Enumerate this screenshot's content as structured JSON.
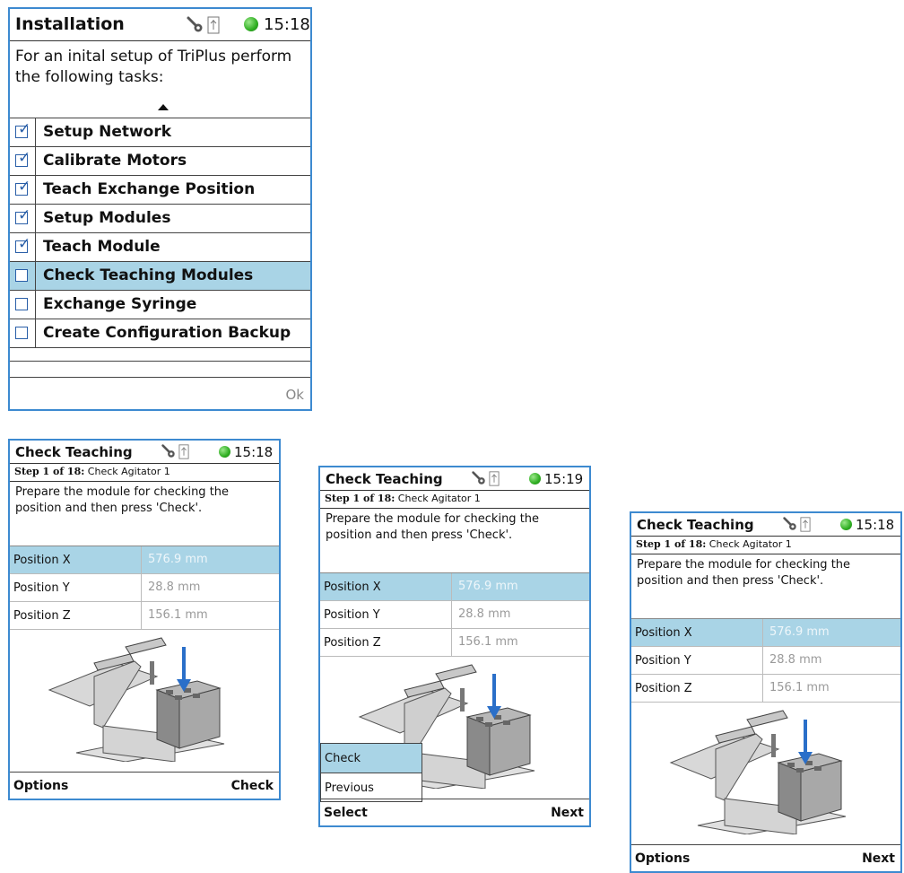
{
  "install": {
    "title": "Installation",
    "time": "15:18",
    "intro": "For an inital setup of TriPlus perform the following tasks:",
    "tasks": [
      {
        "label": "Setup Network",
        "checked": true
      },
      {
        "label": "Calibrate Motors",
        "checked": true
      },
      {
        "label": "Teach Exchange Position",
        "checked": true
      },
      {
        "label": "Setup Modules",
        "checked": true
      },
      {
        "label": "Teach Module",
        "checked": true
      },
      {
        "label": "Check Teaching Modules",
        "checked": false
      },
      {
        "label": "Exchange Syringe",
        "checked": false
      },
      {
        "label": "Create Configuration Backup",
        "checked": false
      }
    ],
    "ok_label": "Ok"
  },
  "check_screens": [
    {
      "title": "Check Teaching",
      "time": "15:18",
      "step_prefix": "Step 1 of 18:",
      "step_name": "Check Agitator 1",
      "instruction": "Prepare the module for checking the position and then press 'Check'.",
      "positions": [
        {
          "label": "Position X",
          "value": "576.9 mm"
        },
        {
          "label": "Position Y",
          "value": "28.8 mm"
        },
        {
          "label": "Position Z",
          "value": "156.1 mm"
        }
      ],
      "left_soft": "Options",
      "right_soft": "Check"
    },
    {
      "title": "Check Teaching",
      "time": "15:19",
      "step_prefix": "Step 1 of 18:",
      "step_name": "Check Agitator 1",
      "instruction": "Prepare the module for checking the position and then press 'Check'.",
      "positions": [
        {
          "label": "Position X",
          "value": "576.9 mm"
        },
        {
          "label": "Position Y",
          "value": "28.8 mm"
        },
        {
          "label": "Position Z",
          "value": "156.1 mm"
        }
      ],
      "menu": [
        "Check",
        "Previous"
      ],
      "left_soft": "Select",
      "right_soft": "Next"
    },
    {
      "title": "Check Teaching",
      "time": "15:18",
      "step_prefix": "Step 1 of 18:",
      "step_name": "Check Agitator 1",
      "instruction": "Prepare the module for checking the position and then press 'Check'.",
      "positions": [
        {
          "label": "Position X",
          "value": "576.9 mm"
        },
        {
          "label": "Position Y",
          "value": "28.8 mm"
        },
        {
          "label": "Position Z",
          "value": "156.1 mm"
        }
      ],
      "left_soft": "Options",
      "right_soft": "Next"
    }
  ]
}
